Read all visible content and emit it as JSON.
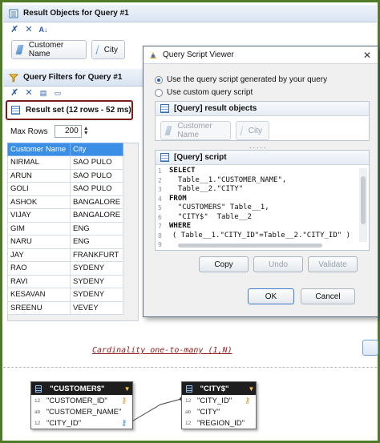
{
  "result_objects": {
    "title": "Result Objects for Query #1",
    "toolbar_icons": [
      "remove-all-icon",
      "remove-icon",
      "sort-az-icon"
    ],
    "items": [
      {
        "label": "Customer Name"
      },
      {
        "label": "City"
      }
    ]
  },
  "query_filters": {
    "title": "Query Filters for Query #1",
    "toolbar_icons": [
      "remove-all-icon",
      "remove-icon",
      "filter-icon",
      "edit-icon"
    ]
  },
  "result_set": {
    "label": "Result set (12 rows - 52 ms)",
    "max_rows_label": "Max Rows",
    "max_rows_value": "200",
    "columns": [
      "Customer Name",
      "City"
    ],
    "rows": [
      [
        "NIRMAL",
        "SAO PULO"
      ],
      [
        "ARUN",
        "SAO PULO"
      ],
      [
        "GOLI",
        "SAO PULO"
      ],
      [
        "ASHOK",
        "BANGALORE"
      ],
      [
        "VIJAY",
        "BANGALORE"
      ],
      [
        "GIM",
        "ENG"
      ],
      [
        "NARU",
        "ENG"
      ],
      [
        "JAY",
        "FRANKFURT"
      ],
      [
        "RAO",
        "SYDENY"
      ],
      [
        "RAVI",
        "SYDENY"
      ],
      [
        "KESAVAN",
        "SYDENY"
      ],
      [
        "SREENU",
        "VEVEY"
      ]
    ]
  },
  "cardinality_text": "Cardinality one-to-many (1,N)",
  "diagram": {
    "customers": {
      "name": "\"CUSTOMER$\"",
      "fields": [
        {
          "type": "12",
          "name": "\"CUSTOMER_ID\"",
          "key": true
        },
        {
          "type": "ab",
          "name": "\"CUSTOMER_NAME\"",
          "key": false
        },
        {
          "type": "12",
          "name": "\"CITY_ID\"",
          "key": true
        }
      ]
    },
    "city": {
      "name": "\"CITY$\"",
      "fields": [
        {
          "type": "12",
          "name": "\"CITY_ID\"",
          "key": true
        },
        {
          "type": "ab",
          "name": "\"CITY\"",
          "key": false
        },
        {
          "type": "12",
          "name": "\"REGION_ID\"",
          "key": false
        }
      ]
    }
  },
  "dialog": {
    "title": "Query Script Viewer",
    "option_generated": "Use the query script generated by your query",
    "option_custom": "Use custom query script",
    "result_objects_header": "[Query] result objects",
    "result_objects": [
      "Customer Name",
      "City"
    ],
    "script_header": "[Query] script",
    "script_lines": [
      {
        "num": "1",
        "text": "SELECT",
        "kw": true
      },
      {
        "num": "2",
        "text": "  Table__1.\"CUSTOMER_NAME\",",
        "kw": false
      },
      {
        "num": "3",
        "text": "  Table__2.\"CITY\"",
        "kw": false
      },
      {
        "num": "4",
        "text": "FROM",
        "kw": true
      },
      {
        "num": "5",
        "text": "  \"CUSTOMERS\" Table__1,",
        "kw": false
      },
      {
        "num": "6",
        "text": "  \"CITY$\"  Table__2",
        "kw": false
      },
      {
        "num": "7",
        "text": "WHERE",
        "kw": true
      },
      {
        "num": "8",
        "text": "  ( Table__1.\"CITY_ID\"=Table__2.\"CITY_ID\" )",
        "kw": false
      },
      {
        "num": "9",
        "text": "",
        "kw": false
      }
    ],
    "buttons": {
      "copy": "Copy",
      "undo": "Undo",
      "validate": "Validate",
      "ok": "OK",
      "cancel": "Cancel"
    }
  }
}
